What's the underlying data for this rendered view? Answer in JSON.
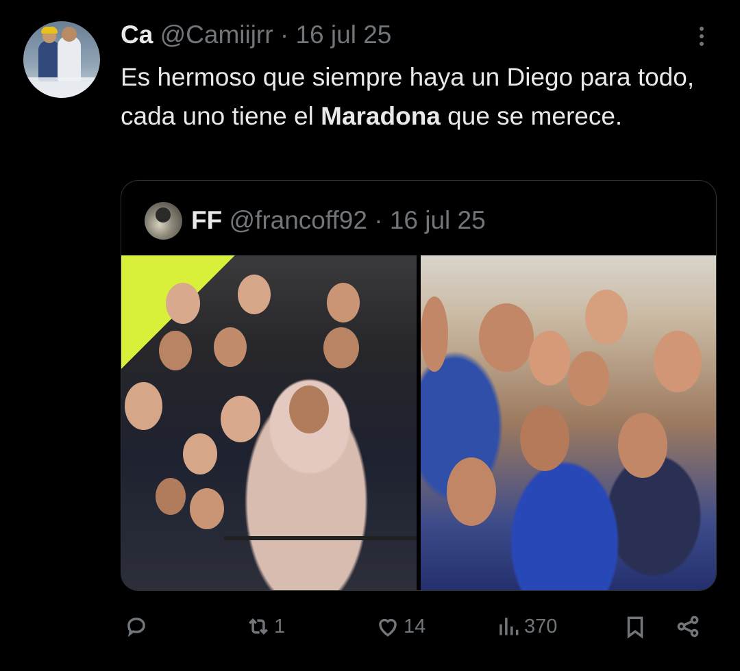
{
  "tweet": {
    "author_name": "Ca",
    "handle": "@Camiijrr",
    "separator": "·",
    "date": "16 jul 25",
    "text_part1": "Es hermoso que siempre haya un Diego para todo, cada uno tiene el ",
    "text_bold": "Maradona",
    "text_part2": " que se merece."
  },
  "quoted": {
    "author_name": "FF",
    "handle": "@francoff92",
    "separator": "·",
    "date": "16 jul 25"
  },
  "actions": {
    "reply_count": "",
    "retweet_count": "1",
    "like_count": "14",
    "views_count": "370"
  },
  "icons": {
    "more": "more-vertical-icon",
    "reply": "reply-icon",
    "retweet": "retweet-icon",
    "like": "heart-icon",
    "views": "views-icon",
    "bookmark": "bookmark-icon",
    "share": "share-icon"
  },
  "colors": {
    "background": "#000000",
    "text": "#e7e9ea",
    "muted": "#71767b",
    "border": "#2f3336"
  }
}
